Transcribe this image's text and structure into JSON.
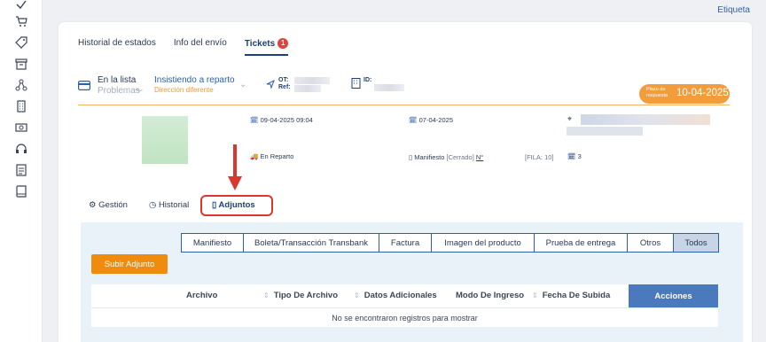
{
  "sidebar": {
    "icons": [
      "check-icon",
      "cart-icon",
      "tag-icon",
      "archive-icon",
      "network-icon",
      "building-icon",
      "cash-icon",
      "headset-icon",
      "document-list-icon",
      "book-icon"
    ]
  },
  "top_link": "Etiqueta",
  "tabs": [
    {
      "label": "Historial de estados",
      "active": false
    },
    {
      "label": "Info del envío",
      "active": false
    },
    {
      "label": "Tickets",
      "active": true,
      "badge": "1"
    }
  ],
  "status": {
    "list_label": "En la lista",
    "list_sub": "Problemas",
    "state_label": "Insistiendo a reparto",
    "state_sub": "Dirección diferente",
    "ot_label": "OT:",
    "ref_label": "Ref:",
    "id_label": "ID:"
  },
  "plazo": {
    "label": "Plazo de respuesta",
    "date": "10-04-2025"
  },
  "details": {
    "date_created": "09-04-2025 09:04",
    "date_other": "07-04-2025",
    "delivery_status": "En Reparto",
    "manifest_label": "Manifiesto",
    "manifest_state": "[Cerrado]",
    "manifest_no": "N°",
    "fila": "[FILA: 10]",
    "count": "3"
  },
  "sub_tabs": [
    {
      "label": "Gestión",
      "icon": "gear-icon"
    },
    {
      "label": "Historial",
      "icon": "clock-icon"
    },
    {
      "label": "Adjuntos",
      "icon": "file-icon",
      "active": true
    }
  ],
  "filters": [
    {
      "label": "Manifiesto",
      "active": false
    },
    {
      "label": "Boleta/Transacción Transbank",
      "active": false
    },
    {
      "label": "Factura",
      "active": false
    },
    {
      "label": "Imagen del producto",
      "active": false
    },
    {
      "label": "Prueba de entrega",
      "active": false
    },
    {
      "label": "Otros",
      "active": false
    },
    {
      "label": "Todos",
      "active": true
    }
  ],
  "upload_button": "Subir Adjunto",
  "table": {
    "columns": [
      "Archivo",
      "Tipo De Archivo",
      "Datos Adicionales",
      "Modo De Ingreso",
      "Fecha De Subida"
    ],
    "actions_header": "Acciones",
    "empty_message": "No se encontraron registros para mostrar"
  },
  "colors": {
    "accent": "#2f5ea8",
    "orange": "#f08c0d",
    "highlight": "#d9382f",
    "header_blue": "#4a79bd"
  }
}
